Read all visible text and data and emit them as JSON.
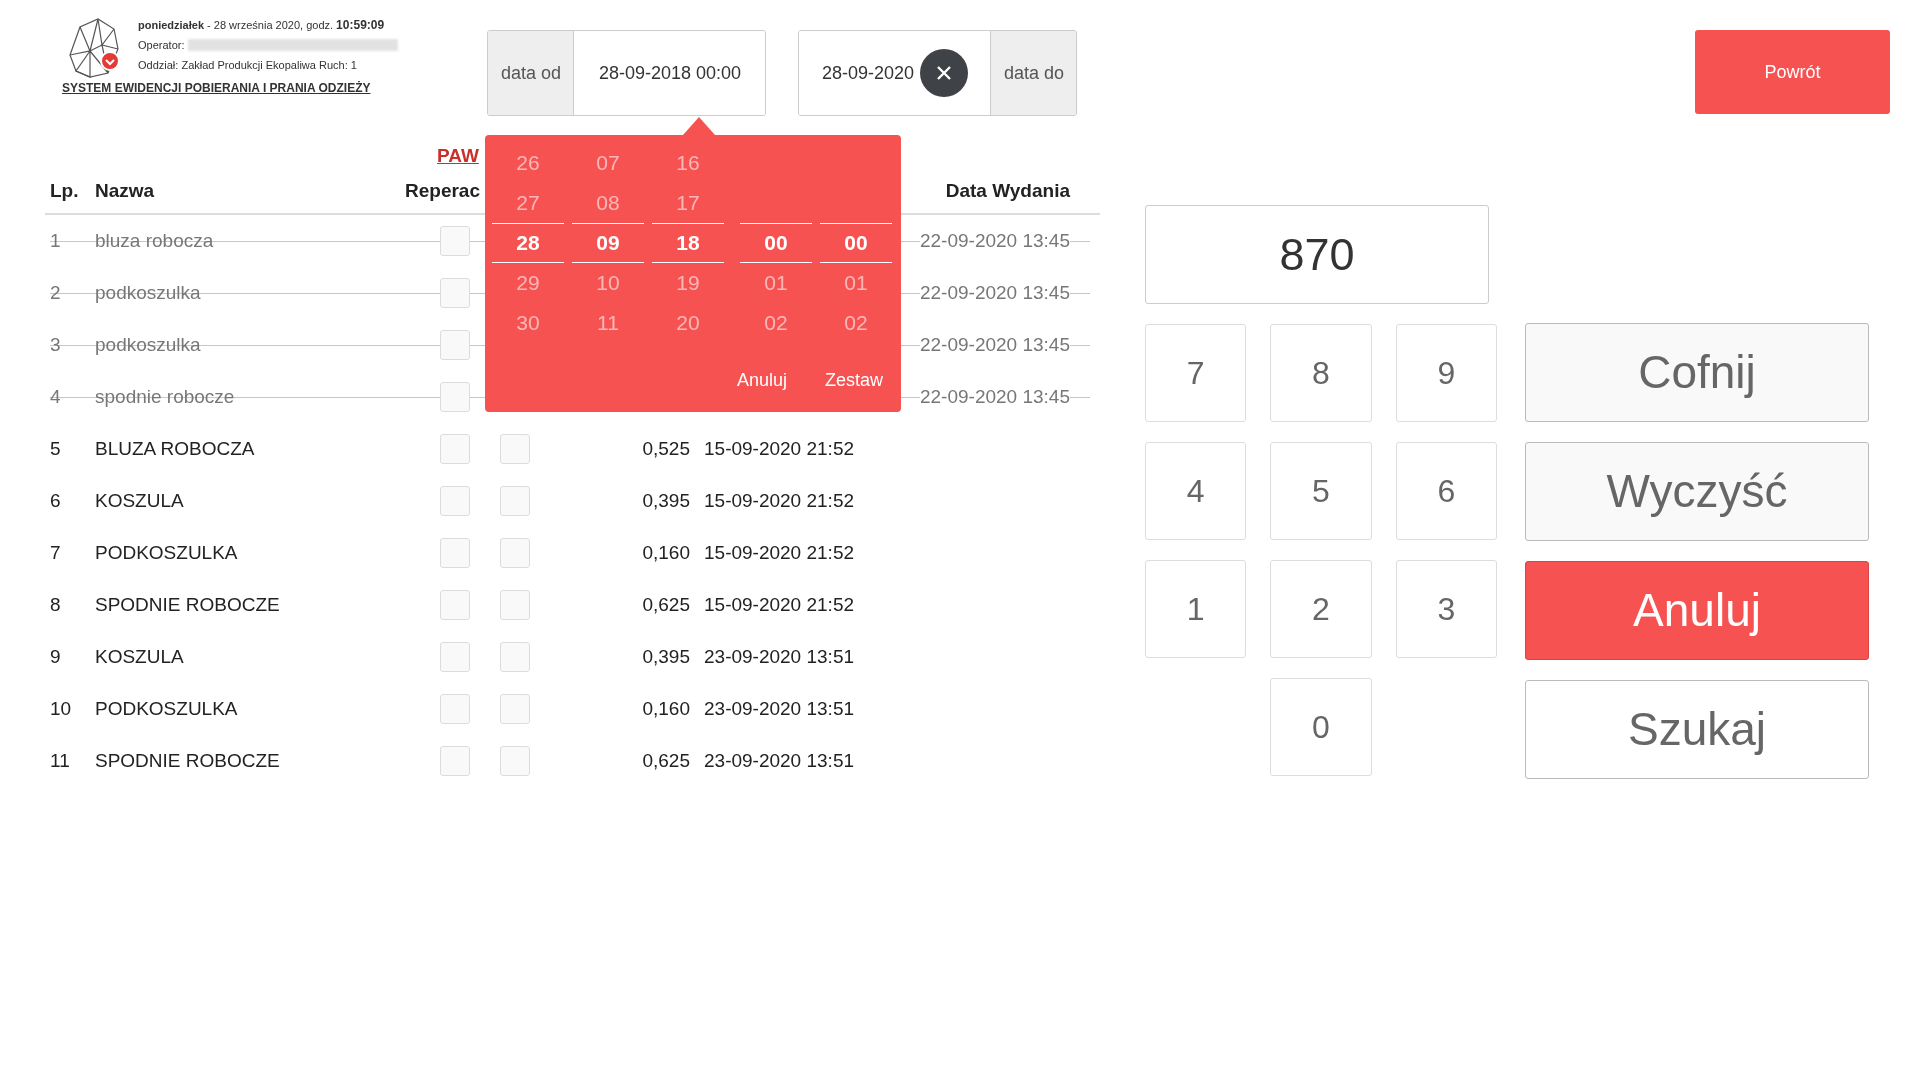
{
  "header": {
    "day": "poniedziałek",
    "date_text": " - 28 września 2020, godz. ",
    "time": "10:59:09",
    "operator_label": "Operator:",
    "department": "Oddział: Zakład Produkcji Ekopaliwa Ruch: 1",
    "system_title": "SYSTEM EWIDENCJI POBIERANIA I PRANIA ODZIEŻY"
  },
  "date_from": {
    "label": "data od",
    "value": "28-09-2018 00:00"
  },
  "date_to": {
    "label": "data do",
    "value": "28-09-2020"
  },
  "back_button": "Powrót",
  "table": {
    "group_link": "PAW",
    "columns": [
      "Lp.",
      "Nazwa",
      "Reperac",
      "Data Wydania"
    ],
    "rows": [
      {
        "lp": "1",
        "name": "bluza robocza",
        "struck": true,
        "checks": [
          false
        ],
        "issued": "22-09-2020 13:45"
      },
      {
        "lp": "2",
        "name": "podkoszulka",
        "struck": true,
        "checks": [
          false
        ],
        "issued": "22-09-2020 13:45"
      },
      {
        "lp": "3",
        "name": "podkoszulka",
        "struck": true,
        "checks": [
          false
        ],
        "issued": "22-09-2020 13:45"
      },
      {
        "lp": "4",
        "name": "spodnie robocze",
        "struck": true,
        "checks": [
          false
        ],
        "issued": "22-09-2020 13:45"
      },
      {
        "lp": "5",
        "name": "BLUZA ROBOCZA",
        "struck": false,
        "checks": [
          false,
          false
        ],
        "weight": "0,525",
        "date": "15-09-2020 21:52"
      },
      {
        "lp": "6",
        "name": "KOSZULA",
        "struck": false,
        "checks": [
          false,
          false
        ],
        "weight": "0,395",
        "date": "15-09-2020 21:52"
      },
      {
        "lp": "7",
        "name": "PODKOSZULKA",
        "struck": false,
        "checks": [
          false,
          false
        ],
        "weight": "0,160",
        "date": "15-09-2020 21:52"
      },
      {
        "lp": "8",
        "name": "SPODNIE ROBOCZE",
        "struck": false,
        "checks": [
          false,
          false
        ],
        "weight": "0,625",
        "date": "15-09-2020 21:52"
      },
      {
        "lp": "9",
        "name": "KOSZULA",
        "struck": false,
        "checks": [
          false,
          false
        ],
        "weight": "0,395",
        "date": "23-09-2020 13:51"
      },
      {
        "lp": "10",
        "name": "PODKOSZULKA",
        "struck": false,
        "checks": [
          false,
          false
        ],
        "weight": "0,160",
        "date": "23-09-2020 13:51"
      },
      {
        "lp": "11",
        "name": "SPODNIE ROBOCZE",
        "struck": false,
        "checks": [
          false,
          false
        ],
        "weight": "0,625",
        "date": "23-09-2020 13:51"
      }
    ]
  },
  "picker": {
    "columns": [
      {
        "items": [
          {
            "value": "26",
            "selected": false
          },
          {
            "value": "27",
            "selected": false
          },
          {
            "value": "28",
            "selected": true
          },
          {
            "value": "29",
            "selected": false
          },
          {
            "value": "30",
            "selected": false
          }
        ]
      },
      {
        "items": [
          {
            "value": "07",
            "selected": false
          },
          {
            "value": "08",
            "selected": false
          },
          {
            "value": "09",
            "selected": true
          },
          {
            "value": "10",
            "selected": false
          },
          {
            "value": "11",
            "selected": false
          }
        ]
      },
      {
        "items": [
          {
            "value": "16",
            "selected": false
          },
          {
            "value": "17",
            "selected": false
          },
          {
            "value": "18",
            "selected": true
          },
          {
            "value": "19",
            "selected": false
          },
          {
            "value": "20",
            "selected": false
          }
        ]
      },
      {
        "items": [
          {
            "value": "00",
            "selected": true
          },
          {
            "value": "01",
            "selected": false
          },
          {
            "value": "02",
            "selected": false
          }
        ]
      },
      {
        "items": [
          {
            "value": "00",
            "selected": true
          },
          {
            "value": "01",
            "selected": false
          },
          {
            "value": "02",
            "selected": false
          }
        ]
      }
    ],
    "buttons": [
      "Anuluj",
      "Zestaw"
    ]
  },
  "keypad": {
    "display": "870",
    "rows": [
      [
        "7",
        "8",
        "9"
      ],
      [
        "4",
        "5",
        "6"
      ],
      [
        "1",
        "2",
        "3"
      ],
      [
        "",
        "0",
        ""
      ]
    ],
    "actions": [
      {
        "label": "Cofnij",
        "kind": "plain"
      },
      {
        "label": "Wyczyść",
        "kind": "plain"
      },
      {
        "label": "Anuluj",
        "kind": "danger"
      },
      {
        "label": "Szukaj",
        "kind": "outline"
      }
    ]
  }
}
